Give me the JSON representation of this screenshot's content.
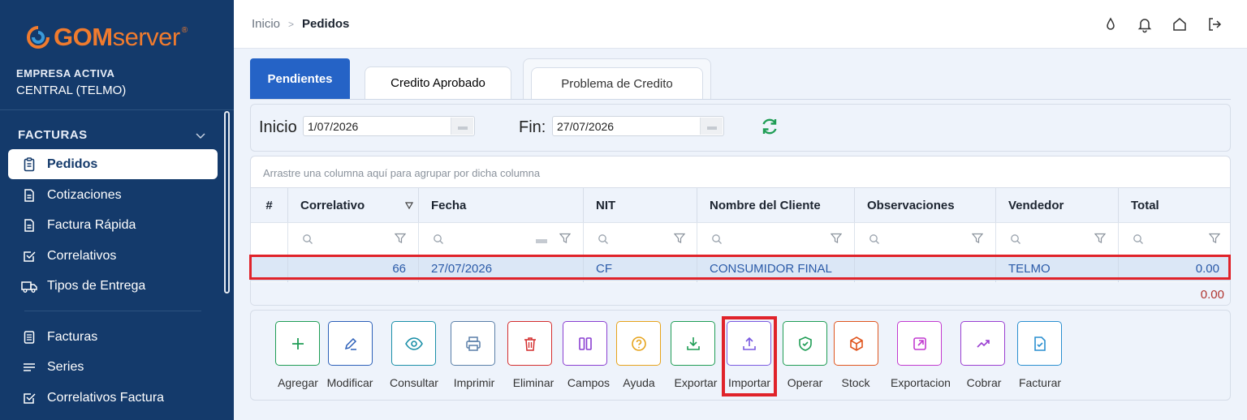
{
  "brand": {
    "logo_bold": "GOM",
    "logo_light": "server",
    "logo_mark": "®",
    "colors": {
      "sidebar": "#143a6b",
      "accent": "#2563c6",
      "logo": "#f07b2e"
    }
  },
  "empresa": {
    "label": "EMPRESA ACTIVA",
    "name": "CENTRAL (TELMO)"
  },
  "sidebar": {
    "section": "FACTURAS",
    "items": [
      {
        "label": "Pedidos",
        "icon": "clipboard-icon",
        "active": true
      },
      {
        "label": "Cotizaciones",
        "icon": "document-icon"
      },
      {
        "label": "Factura Rápida",
        "icon": "document-icon"
      },
      {
        "label": "Correlativos",
        "icon": "checkbox-icon"
      },
      {
        "label": "Tipos de Entrega",
        "icon": "truck-icon"
      },
      {
        "label": "Facturas",
        "icon": "list-doc-icon"
      },
      {
        "label": "Series",
        "icon": "lines-icon"
      },
      {
        "label": "Correlativos Factura",
        "icon": "checkbox-icon"
      }
    ]
  },
  "header": {
    "crumb_home": "Inicio",
    "crumb_current": "Pedidos",
    "icons": [
      "drop-icon",
      "bell-icon",
      "home-icon",
      "logout-icon"
    ]
  },
  "tabs": [
    "Pendientes",
    "Credito Aprobado",
    "Problema de Credito"
  ],
  "filter": {
    "start_label": "Inicio",
    "start_value": "1/07/2026",
    "end_label": "Fin:",
    "end_value": "27/07/2026"
  },
  "grid": {
    "group_hint": "Arrastre una columna aquí para agrupar por dicha columna",
    "columns": [
      "#",
      "Correlativo",
      "Fecha",
      "NIT",
      "Nombre del Cliente",
      "Observaciones",
      "Vendedor",
      "Total"
    ],
    "rows": [
      {
        "correlativo": "66",
        "fecha": "27/07/2026",
        "nit": "CF",
        "cliente": "CONSUMIDOR FINAL",
        "observaciones": "",
        "vendedor": "TELMO",
        "total": "0.00"
      }
    ],
    "footer_total": "0.00"
  },
  "actions": [
    {
      "label": "Agregar",
      "icon": "plus-icon",
      "color": "#1f9d55"
    },
    {
      "label": "Modificar",
      "icon": "pencil-icon",
      "color": "#2b5fb8"
    },
    {
      "label": "Consultar",
      "icon": "eye-icon",
      "color": "#1a8fa8"
    },
    {
      "label": "Imprimir",
      "icon": "printer-icon",
      "color": "#5a7fa8"
    },
    {
      "label": "Eliminar",
      "icon": "trash-icon",
      "color": "#d42d2d"
    },
    {
      "label": "Campos",
      "icon": "columns-icon",
      "color": "#8a3fd1"
    },
    {
      "label": "Ayuda",
      "icon": "help-icon",
      "color": "#e6a31b"
    },
    {
      "label": "Exportar",
      "icon": "download-icon",
      "color": "#1f9d55"
    },
    {
      "label": "Importar",
      "icon": "upload-icon",
      "color": "#7a5ae0"
    },
    {
      "label": "Operar",
      "icon": "shield-icon",
      "color": "#1f9d55"
    },
    {
      "label": "Stock",
      "icon": "box-icon",
      "color": "#e0551e"
    },
    {
      "label": "Exportacion",
      "icon": "external-icon",
      "color": "#c23ad0"
    },
    {
      "label": "Cobrar",
      "icon": "trend-icon",
      "color": "#9a3fd1"
    },
    {
      "label": "Facturar",
      "icon": "doc-check-icon",
      "color": "#2a8fd0"
    }
  ]
}
